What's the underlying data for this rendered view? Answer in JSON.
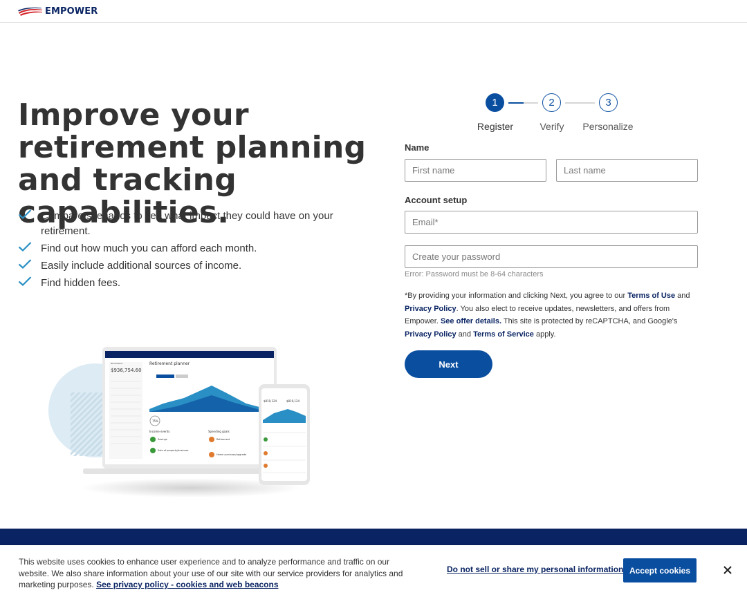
{
  "brand": {
    "name": "EMPOWER",
    "primary": "#0a4ea0",
    "navy": "#0a2463"
  },
  "hero": {
    "headline": "Improve your retirement planning and tracking capabilities.",
    "benefits": [
      "Compare scenarios to see what impact they could have on your retirement.",
      "Find out how much you can afford each month.",
      "Easily include additional sources of income.",
      "Find hidden fees."
    ]
  },
  "illustration": {
    "account_label": "NETWORTH",
    "balance": "$936,754.60",
    "planner_title": "Retirement planner",
    "phone_balance_1": "$819,124",
    "phone_balance_2": "$819,124",
    "tip_badge": "75%",
    "income_events": "Income events",
    "spending_goals": "Spending goals",
    "event_1": "Savings",
    "event_2": "Sale of property/business",
    "goal_1": "Retirement",
    "goal_2": "Home purchase/upgrade"
  },
  "stepper": {
    "steps": [
      {
        "number": "1",
        "label": "Register",
        "state": "active"
      },
      {
        "number": "2",
        "label": "Verify",
        "state": "pending"
      },
      {
        "number": "3",
        "label": "Personalize",
        "state": "pending"
      }
    ],
    "progress_first_connector": 0.5
  },
  "form": {
    "name_label": "Name",
    "first_name_placeholder": "First name",
    "last_name_placeholder": "Last name",
    "account_setup_label": "Account setup",
    "email_placeholder": "Email*",
    "password_placeholder": "Create your password",
    "password_error": "Error: Password must be 8-64 characters",
    "legal": {
      "p1": "*By providing your information and clicking Next, you agree to our ",
      "terms_of_use": "Terms of Use",
      "p2": " and ",
      "privacy_policy": "Privacy Policy",
      "p3": ". You also elect to receive updates, newsletters, and offers from Empower. ",
      "offer_details": "See offer details.",
      "p4": " This site is protected by reCAPTCHA, and Google's ",
      "google_privacy": "Privacy Policy",
      "p5": " and ",
      "terms_of_service": "Terms of Service",
      "p6": " apply."
    },
    "next_label": "Next"
  },
  "cookie_banner": {
    "text": "This website uses cookies to enhance user experience and to analyze performance and traffic on our website. We also share information about your use of our site with our service providers for analytics and marketing purposes. ",
    "policy_link": "See privacy policy - cookies and web beacons",
    "do_not_sell": "Do not sell or share my personal information",
    "accept_label": "Accept cookies",
    "close_icon": "close-icon"
  }
}
